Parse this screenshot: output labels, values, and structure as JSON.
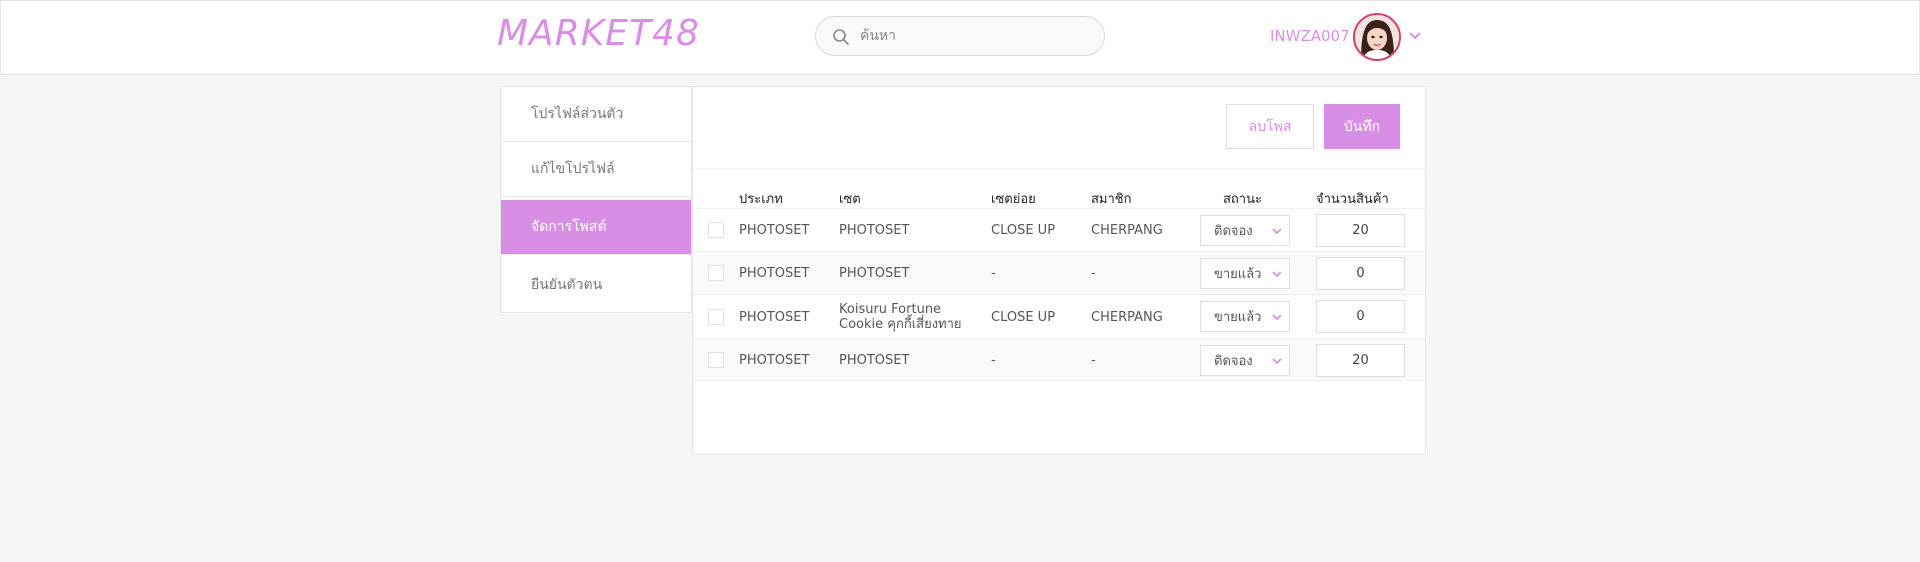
{
  "header": {
    "logo": "MARKET48",
    "search_placeholder": "ค้นหา",
    "username": "INWZA007"
  },
  "sidebar": {
    "items": [
      {
        "label": "โปรไฟล์ส่วนตัว",
        "active": false
      },
      {
        "label": "แก้ไขโปรไฟล์",
        "active": false
      },
      {
        "label": "จัดการโพสต์",
        "active": true
      },
      {
        "label": "ยืนยันตัวตน",
        "active": false
      }
    ]
  },
  "actions": {
    "delete_label": "ลบโพส",
    "save_label": "บันทึก"
  },
  "table": {
    "headers": [
      "ประเภท",
      "เซต",
      "เซตย่อย",
      "สมาชิก",
      "สถานะ",
      "จำนวนสินค้า"
    ],
    "rows": [
      {
        "type": "PHOTOSET",
        "set": "PHOTOSET",
        "subset": "CLOSE UP",
        "member": "CHERPANG",
        "status": "ติดจอง",
        "qty": "20"
      },
      {
        "type": "PHOTOSET",
        "set": "PHOTOSET",
        "subset": "-",
        "member": "-",
        "status": "ขายแล้ว",
        "qty": "0"
      },
      {
        "type": "PHOTOSET",
        "set_line1": "Koisuru Fortune",
        "set_line2": "Cookie คุกกี้เสี่ยงทาย",
        "subset": "CLOSE UP",
        "member": "CHERPANG",
        "status": "ขายแล้ว",
        "qty": "0"
      },
      {
        "type": "PHOTOSET",
        "set": "PHOTOSET",
        "subset": "-",
        "member": "-",
        "status": "ติดจอง",
        "qty": "20"
      }
    ]
  },
  "icons": {
    "search": "search-icon",
    "dropdown": "chevron-down-icon"
  },
  "colors": {
    "accent": "#d98ee6",
    "avatar_ring": "#d3406a"
  }
}
